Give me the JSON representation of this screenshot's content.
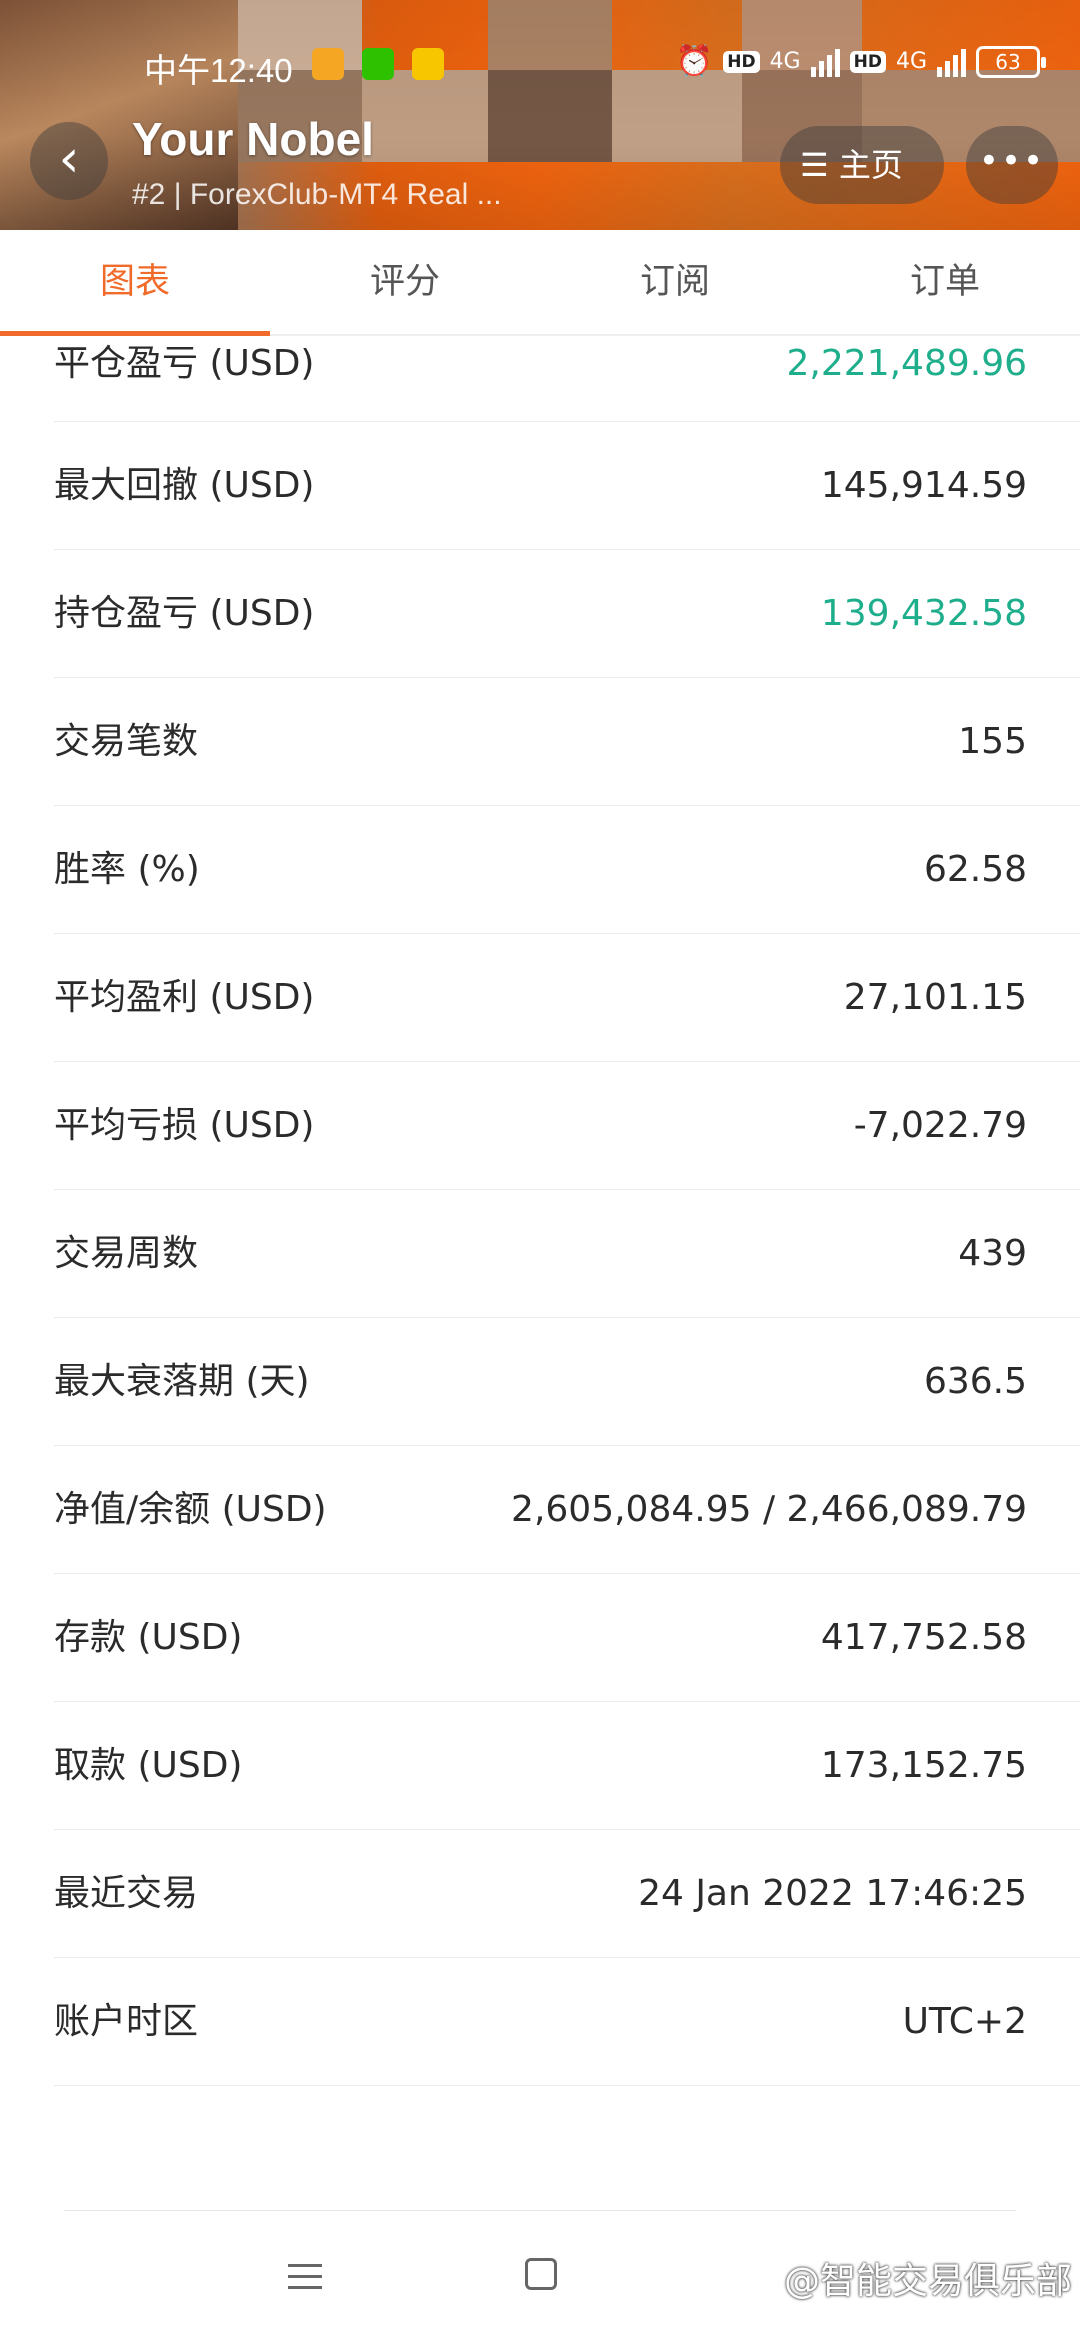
{
  "status_bar": {
    "time": "中午12:40",
    "hd_1": "HD",
    "network_1": "4G",
    "hd_2": "HD",
    "network_2": "4G",
    "battery": "63"
  },
  "header": {
    "title": "Your Nobel",
    "subtitle": "#2 | ForexClub-MT4 Real ...",
    "home_label": "主页",
    "more_label": "•••",
    "back_label": "‹"
  },
  "tabs": [
    {
      "label": "图表",
      "active": true
    },
    {
      "label": "评分",
      "active": false
    },
    {
      "label": "订阅",
      "active": false
    },
    {
      "label": "订单",
      "active": false
    }
  ],
  "stats": [
    {
      "label": "平仓盈亏 (USD)",
      "value": "2,221,489.96",
      "color": "green"
    },
    {
      "label": "最大回撤 (USD)",
      "value": "145,914.59",
      "color": "default"
    },
    {
      "label": "持仓盈亏 (USD)",
      "value": "139,432.58",
      "color": "green"
    },
    {
      "label": "交易笔数",
      "value": "155",
      "color": "default"
    },
    {
      "label": "胜率 (%)",
      "value": "62.58",
      "color": "default"
    },
    {
      "label": "平均盈利 (USD)",
      "value": "27,101.15",
      "color": "default"
    },
    {
      "label": "平均亏损 (USD)",
      "value": "-7,022.79",
      "color": "default"
    },
    {
      "label": "交易周数",
      "value": "439",
      "color": "default"
    },
    {
      "label": "最大衰落期 (天)",
      "value": "636.5",
      "color": "default"
    },
    {
      "label": "净值/余额 (USD)",
      "value": "2,605,084.95 / 2,466,089.79",
      "color": "default"
    },
    {
      "label": "存款 (USD)",
      "value": "417,752.58",
      "color": "default"
    },
    {
      "label": "取款 (USD)",
      "value": "173,152.75",
      "color": "default"
    },
    {
      "label": "最近交易",
      "value": "24 Jan 2022 17:46:25",
      "color": "default"
    },
    {
      "label": "账户时区",
      "value": "UTC+2",
      "color": "default"
    }
  ],
  "watermark": "@智能交易俱乐部",
  "colors": {
    "accent": "#f06a2a",
    "positive": "#1fae8c",
    "header_orange": "#ff6a10"
  }
}
